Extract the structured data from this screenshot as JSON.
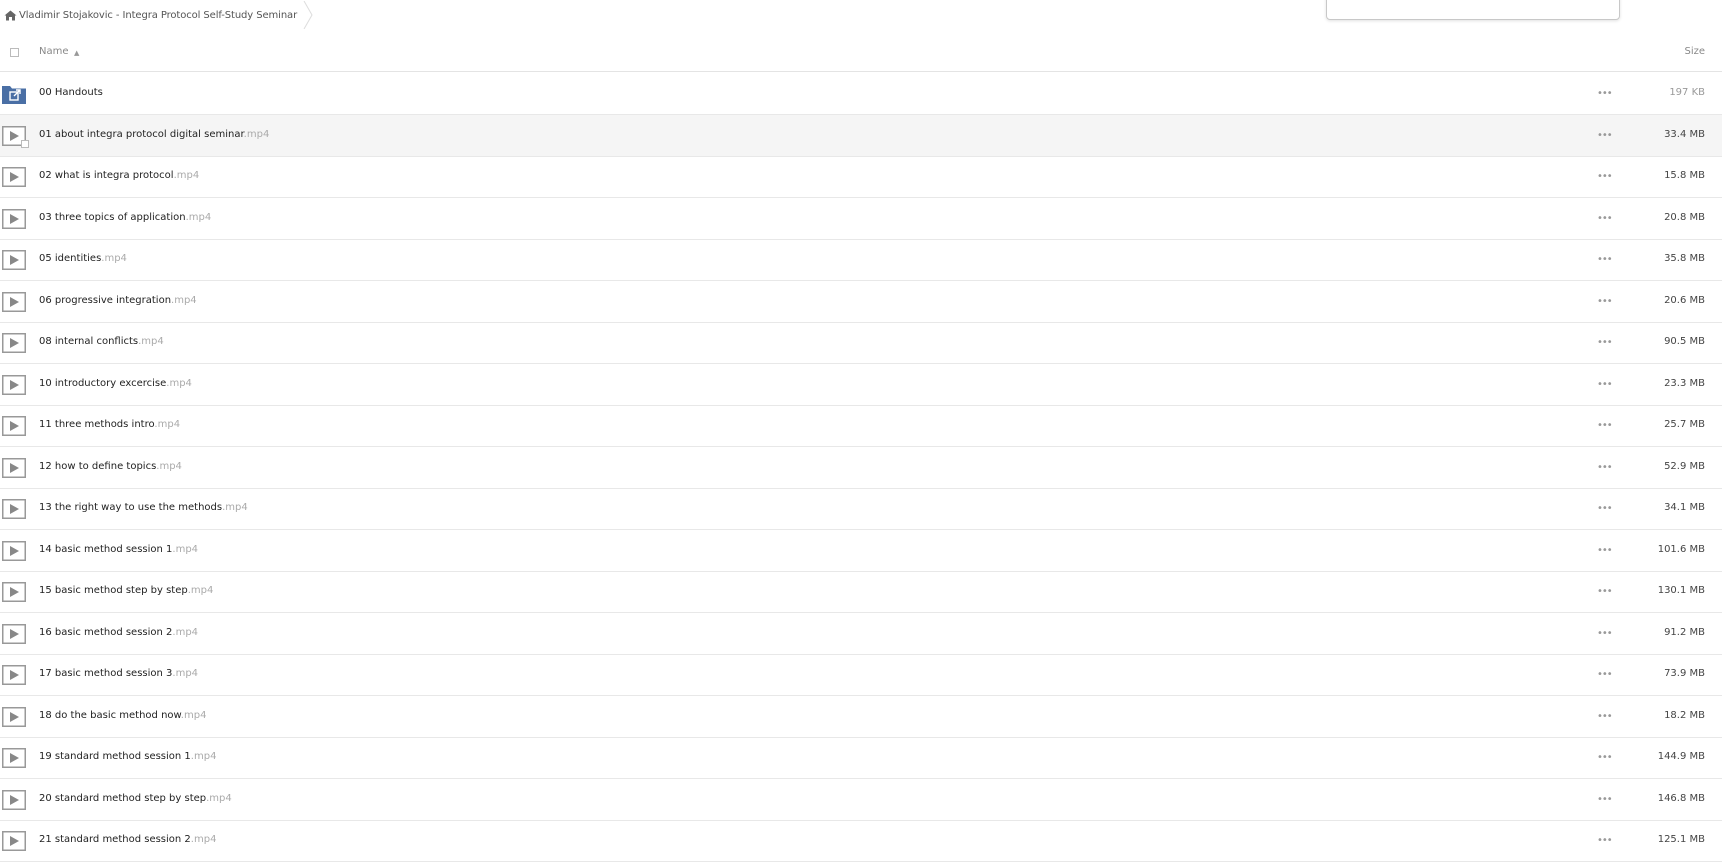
{
  "breadcrumb": {
    "label": "Vladimir Stojakovic - Integra Protocol Self-Study Seminar"
  },
  "header": {
    "name": "Name",
    "size": "Size"
  },
  "more_label": "•••",
  "files": [
    {
      "name": "00 Handouts",
      "ext": "",
      "size": "197 KB",
      "type": "folder"
    },
    {
      "name": "01 about integra protocol digital seminar",
      "ext": ".mp4",
      "size": "33.4 MB",
      "type": "video"
    },
    {
      "name": "02 what is integra protocol",
      "ext": ".mp4",
      "size": "15.8 MB",
      "type": "video"
    },
    {
      "name": "03 three topics of application",
      "ext": ".mp4",
      "size": "20.8 MB",
      "type": "video"
    },
    {
      "name": "05 identities",
      "ext": ".mp4",
      "size": "35.8 MB",
      "type": "video"
    },
    {
      "name": "06 progressive integration",
      "ext": ".mp4",
      "size": "20.6 MB",
      "type": "video"
    },
    {
      "name": "08 internal conflicts",
      "ext": ".mp4",
      "size": "90.5 MB",
      "type": "video"
    },
    {
      "name": "10 introductory excercise",
      "ext": ".mp4",
      "size": "23.3 MB",
      "type": "video"
    },
    {
      "name": "11 three methods intro",
      "ext": ".mp4",
      "size": "25.7 MB",
      "type": "video"
    },
    {
      "name": "12 how to define topics",
      "ext": ".mp4",
      "size": "52.9 MB",
      "type": "video"
    },
    {
      "name": "13 the right way to use the methods",
      "ext": ".mp4",
      "size": "34.1 MB",
      "type": "video"
    },
    {
      "name": "14 basic method session 1",
      "ext": ".mp4",
      "size": "101.6 MB",
      "type": "video"
    },
    {
      "name": "15 basic method step by step",
      "ext": ".mp4",
      "size": "130.1 MB",
      "type": "video"
    },
    {
      "name": "16 basic method session 2",
      "ext": ".mp4",
      "size": "91.2 MB",
      "type": "video"
    },
    {
      "name": "17 basic method session 3",
      "ext": ".mp4",
      "size": "73.9 MB",
      "type": "video"
    },
    {
      "name": "18 do the basic method now",
      "ext": ".mp4",
      "size": "18.2 MB",
      "type": "video"
    },
    {
      "name": "19 standard method session 1",
      "ext": ".mp4",
      "size": "144.9 MB",
      "type": "video"
    },
    {
      "name": "20 standard method step by step",
      "ext": ".mp4",
      "size": "146.8 MB",
      "type": "video"
    },
    {
      "name": "21 standard method session 2",
      "ext": ".mp4",
      "size": "125.1 MB",
      "type": "video"
    }
  ]
}
